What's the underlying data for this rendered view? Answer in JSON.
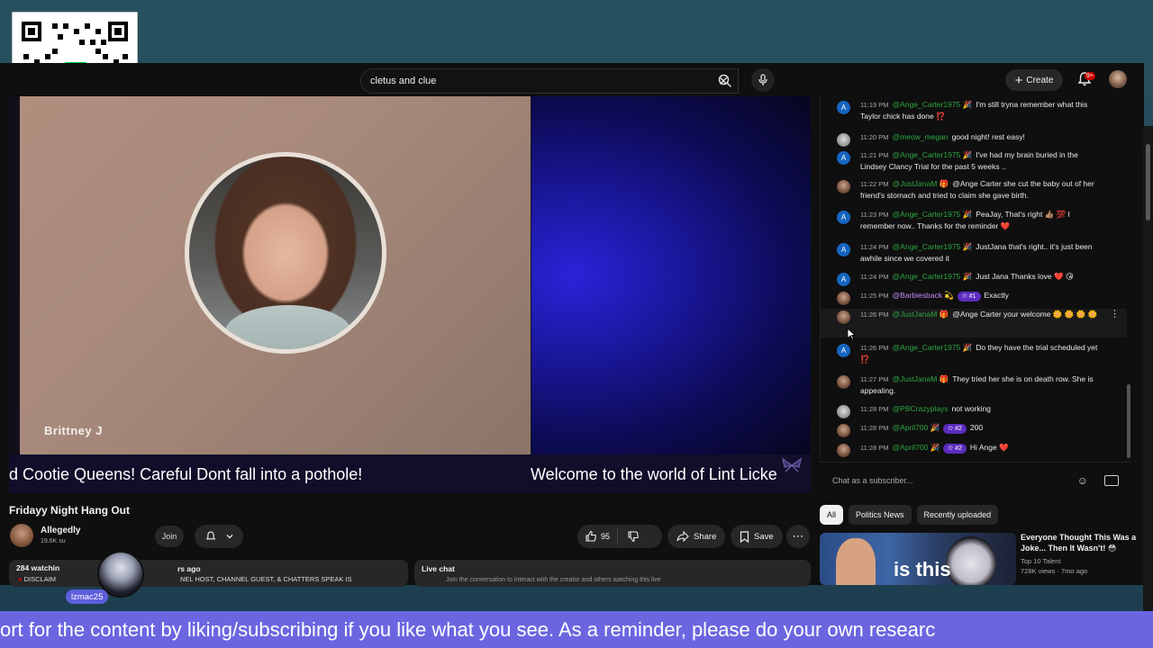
{
  "search": {
    "value": "cletus and clue"
  },
  "header": {
    "create_label": "Create",
    "notification_count": "9+"
  },
  "video": {
    "name_tag": "Brittney J",
    "ticker_left": "d Cootie Queens!  Careful Dont fall into a pothole!",
    "ticker_right": "Welcome to the world of Lint Licke"
  },
  "meta": {
    "title": "Fridayy Night Hang Out",
    "channel_name": "Allegedly",
    "channel_subs": "19.6K su",
    "join_label": "Join",
    "like_count": "95",
    "share_label": "Share",
    "save_label": "Save",
    "views": "284 watchin",
    "ago": "rs ago",
    "disclaimer": "DISCLAIM",
    "disclaimer_rest": "NEL HOST, CHANNEL GUEST, & CHATTERS SPEAK IS",
    "live_chat_label": "Live chat",
    "live_chat_sub": "Join the conversation to interact with the creator and others watching this live"
  },
  "chat": {
    "messages": [
      {
        "time": "11:19 PM",
        "user": "@Ange_Carter1975 🎉",
        "text": "I'm still tryna remember what this Taylor chick has done ⁉️",
        "avatar": "A"
      },
      {
        "time": "11:20 PM",
        "user": "@meow_megan",
        "text": "good night! rest easy!",
        "avatar": ""
      },
      {
        "time": "11:21 PM",
        "user": "@Ange_Carter1975 🎉",
        "text": "I've had my brain buried in the Lindsey Clancy Trial for the past 5 weeks ..",
        "avatar": "A"
      },
      {
        "time": "11:22 PM",
        "user": "@JustJanaM 🎁",
        "text": "@Ange Carter she cut the baby out of her friend's stomach and tried to claim she gave birth.",
        "avatar": ""
      },
      {
        "time": "11:23 PM",
        "user": "@Ange_Carter1975 🎉",
        "text": "PeaJay, That's right 👍🏽 💯 I remember now.. Thanks for the reminder ❤️",
        "avatar": "A"
      },
      {
        "time": "11:24 PM",
        "user": "@Ange_Carter1975 🎉",
        "text": "JustJana that's right.. it's just been awhile since we covered it",
        "avatar": "A"
      },
      {
        "time": "11:24 PM",
        "user": "@Ange_Carter1975 🎉",
        "text": "Just Jana Thanks love ❤️ 😘",
        "avatar": "A"
      },
      {
        "time": "11:25 PM",
        "user": "@Barbiesback 💫",
        "badge": "✩ #1",
        "text": "Exactly",
        "avatar": ""
      },
      {
        "time": "11:26 PM",
        "user": "@JustJanaM 🎁",
        "text": "@Ange Carter your welcome 🌼 🌼 🌼 🌼",
        "avatar": ""
      },
      {
        "time": "11:26 PM",
        "user": "@Ange_Carter1975 🎉",
        "text": "Do they have the trial scheduled yet ⁉️",
        "avatar": "A"
      },
      {
        "time": "11:27 PM",
        "user": "@JustJanaM 🎁",
        "text": "They tried her she is on death row. She is appealing.",
        "avatar": ""
      },
      {
        "time": "11:28 PM",
        "user": "@PBCrazyplays",
        "text": "not working",
        "avatar": ""
      },
      {
        "time": "11:28 PM",
        "user": "@April700 🎉",
        "badge": "✩ #2",
        "text": "200",
        "avatar": ""
      },
      {
        "time": "11:28 PM",
        "user": "@April700 🎉",
        "badge": "✩ #2",
        "text": "Hi Ange ❤️",
        "avatar": ""
      }
    ],
    "input_placeholder": "Chat as a subscriber..."
  },
  "chips": [
    "All",
    "Politics News",
    "Recently uploaded"
  ],
  "recommendation": {
    "thumb_text": "is this",
    "title": "Everyone Thought This Was a Joke... Then It Wasn't! 😳",
    "channel": "Top 10 Talent",
    "stats": "728K views · 7mo ago"
  },
  "overlay": {
    "bubble_name": "lzmac25",
    "marquee": "ort for the content by liking/subscribing if you like what you see. As a reminder, please do your own researc"
  },
  "colors": {
    "accent_green": "#2ba640",
    "cash_green": "#00d632",
    "marquee_bg": "#6b66e0",
    "badge_purple": "#5c2cbf"
  }
}
